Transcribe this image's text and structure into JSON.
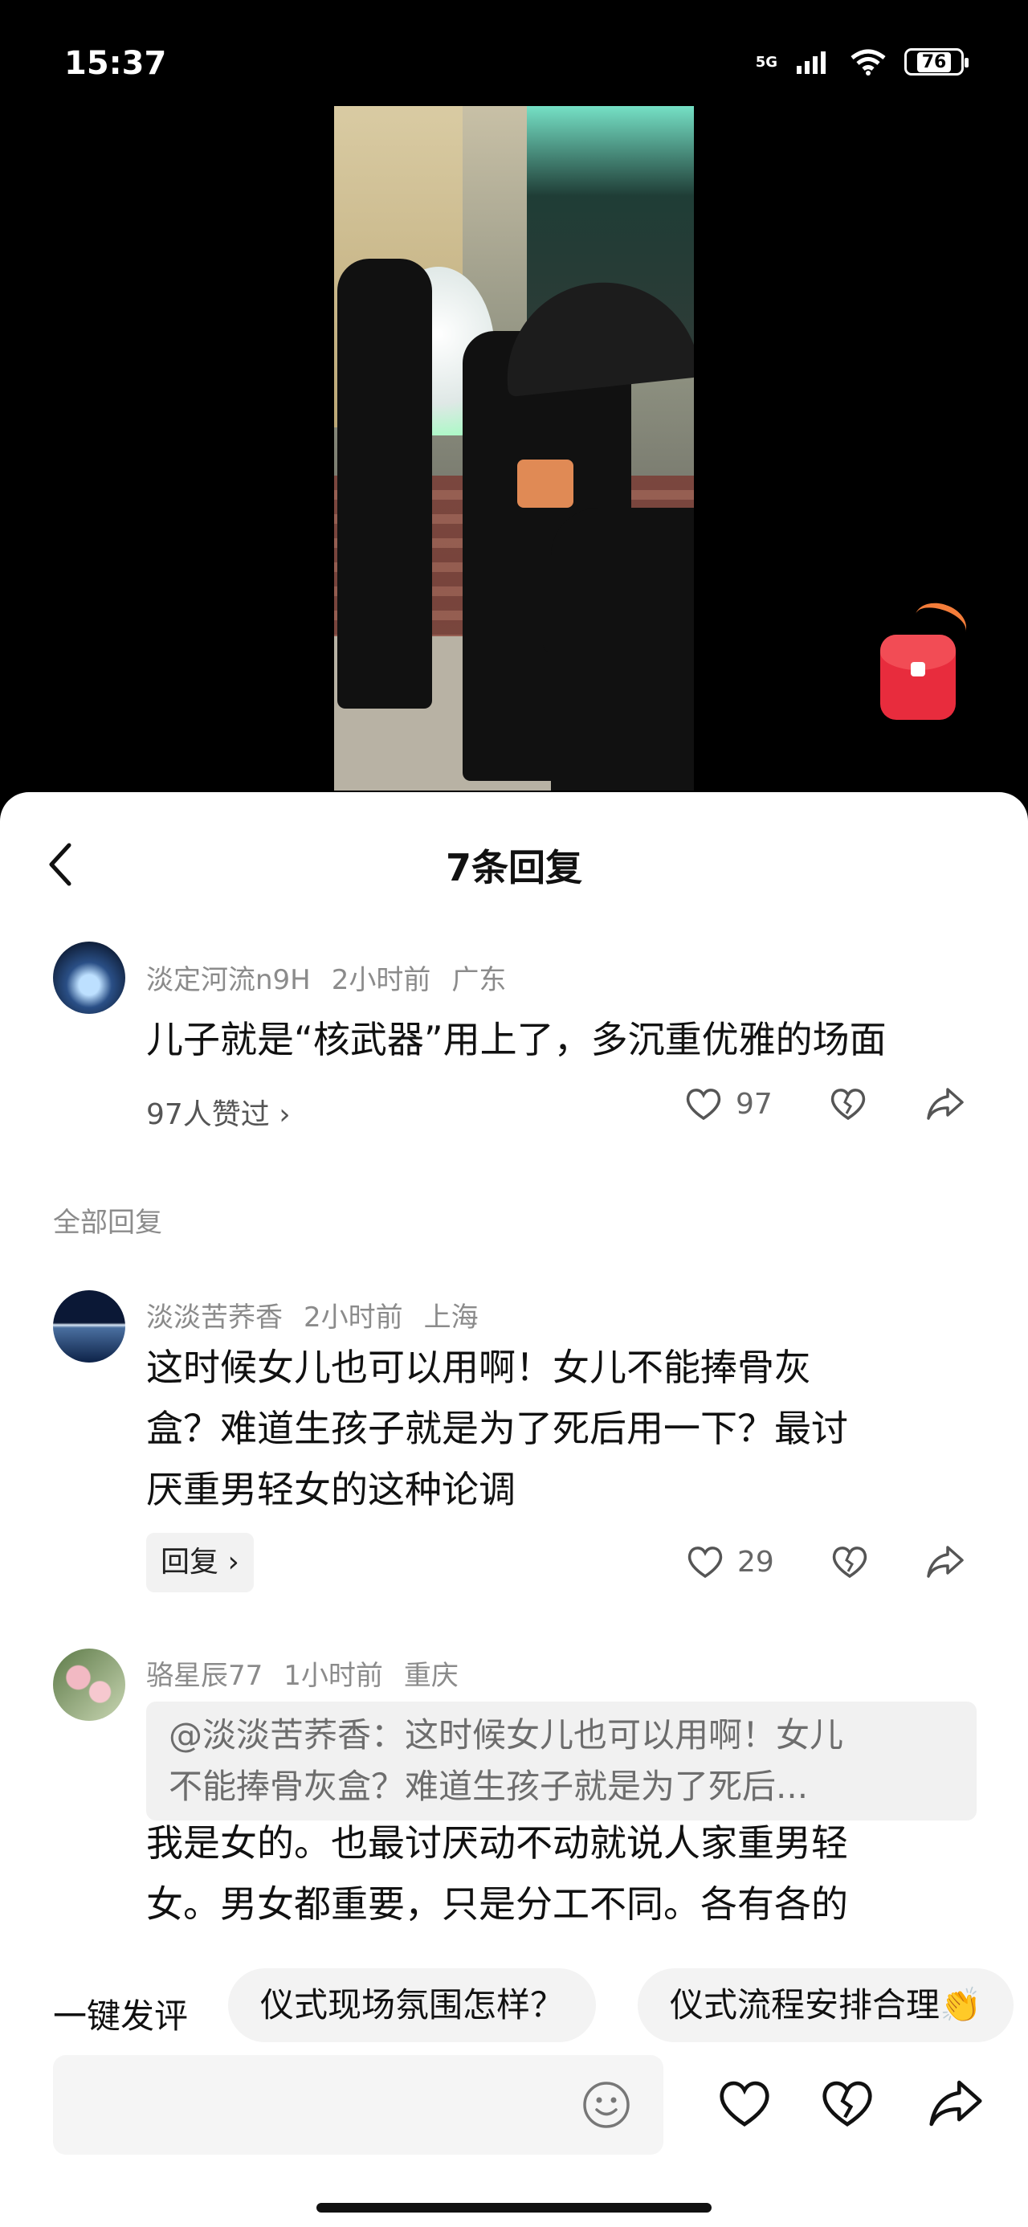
{
  "status_bar": {
    "time": "15:37",
    "network": "5G",
    "battery": "76"
  },
  "sheet": {
    "title": "7条回复"
  },
  "main_comment": {
    "user": "淡定河流n9H",
    "time": "2小时前",
    "location": "广东",
    "text": "儿子就是“核武器”用上了，多沉重优雅的场面",
    "liked_by": "97人赞过 ›",
    "likes": "97"
  },
  "section": {
    "label": "全部回复"
  },
  "replies": [
    {
      "user": "淡淡苦荞香",
      "time": "2小时前",
      "location": "上海",
      "text_lines": [
        "这时候女儿也可以用啊！女儿不能捧骨灰",
        "盒？难道生孩子就是为了死后用一下？最讨",
        "厌重男轻女的这种论调"
      ],
      "reply_label": "回复 ›",
      "likes": "29"
    },
    {
      "user": "骆星辰77",
      "time": "1小时前",
      "location": "重庆",
      "quote_lines": [
        "@淡淡苦荞香：这时候女儿也可以用啊！女儿",
        "不能捧骨灰盒？难道生孩子就是为了死后..."
      ],
      "text_lines": [
        "我是女的。也最讨厌动不动就说人家重男轻",
        "女。男女都重要，只是分工不同。各有各的"
      ]
    }
  ],
  "quick_reply": {
    "label": "一键发评",
    "chips": [
      "仪式现场氛围怎样？",
      "仪式流程安排合理👏"
    ]
  },
  "icons": {
    "like": "heart-icon",
    "dislike": "broken-heart-icon",
    "share": "share-arrow-icon",
    "emoji": "emoji-icon",
    "back": "chevron-left-icon"
  }
}
